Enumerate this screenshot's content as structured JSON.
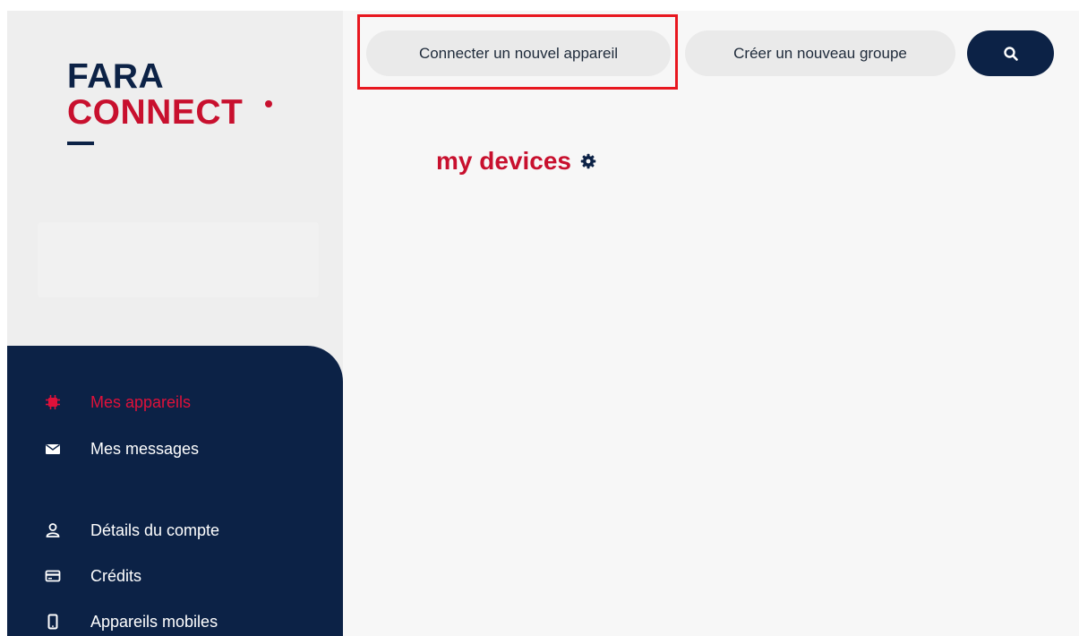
{
  "brand": {
    "line1": "FARA",
    "line2": "CONNECT",
    "colors": {
      "navy": "#0c2246",
      "red": "#c8102e",
      "active": "#e0113a"
    }
  },
  "toolbar": {
    "connect_label": "Connecter un nouvel appareil",
    "create_group_label": "Créer un nouveau groupe",
    "search_icon": "search-icon"
  },
  "main": {
    "title": "my devices",
    "title_icon": "gear-icon"
  },
  "nav": {
    "items": [
      {
        "label": "Mes appareils",
        "icon": "chip-icon",
        "active": true
      },
      {
        "label": "Mes messages",
        "icon": "envelope-icon"
      },
      {
        "label": "Détails du compte",
        "icon": "user-icon"
      },
      {
        "label": "Crédits",
        "icon": "credit-card-icon"
      },
      {
        "label": "Appareils mobiles",
        "icon": "mobile-icon"
      }
    ]
  }
}
